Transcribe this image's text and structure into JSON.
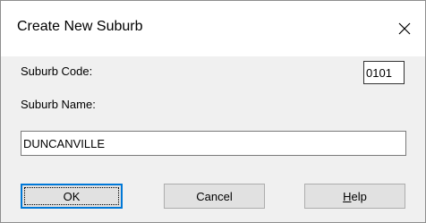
{
  "window": {
    "title": "Create New Suburb",
    "close_icon": "close-icon"
  },
  "form": {
    "suburb_code_label": "Suburb Code:",
    "suburb_code_value": "0101",
    "suburb_name_label": "Suburb Name:",
    "suburb_name_value": "DUNCANVILLE"
  },
  "buttons": {
    "ok_label": "OK",
    "cancel_label": "Cancel",
    "help_mnemonic": "H",
    "help_rest": "elp"
  },
  "colors": {
    "focus_border": "#0078d7",
    "button_face": "#e1e1e1",
    "dialog_background": "#f0f0f0"
  }
}
